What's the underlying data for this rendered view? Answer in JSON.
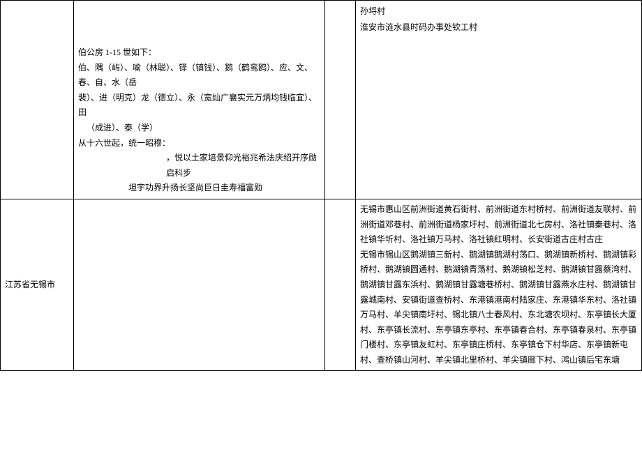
{
  "rows": [
    {
      "region": "",
      "lineage": {
        "title": "伯公房 1-15 世如下：",
        "line1": "伯、隅（屿）、喻（林聪）、铎（镇钱）、鹅（鹤鸾鸥）、应、文、春、自、水（岳",
        "line2": "裴）、进（明克）龙（德立）、永（宽灿广襄实元万炳均钱临宜）、田",
        "line3": "（成进）、泰（学）",
        "line4": "从十六世起，统一昭穆：",
        "line5": "，悦以土家培景仰光裕兆希法庆绍开序勋启科步",
        "line6": "坦宇功界升扬长坚尚巨日圭寿福富勋"
      },
      "locations": {
        "line1": "孙埒村",
        "line2": "淮安市涟水县时码办事处钦工村"
      }
    },
    {
      "region": "江苏省无锡市",
      "lineage": {},
      "locations": {
        "para1": "无锡市惠山区前洲街道黄石街村、前洲街道东村桥村、前洲街道友联村、前洲街道邓巷村、前洲街道杨家圩村、前洲街道北七房村、洛社镇秦巷村、洛社镇华圻村、洛社镇万马村、洛社镇红明村、长安街道古庄村古庄",
        "para2": "无锡市锡山区鹅湖镇三新村、鹅湖镇鹅湖村荡口、鹅湖镇新桥村、鹅湖镇彩桥村、鹅湖镇圆通村、鹅湖镇青荡村、鹅湖镇松芝村、鹅湖镇甘露蔡湾村、鹅湖镇甘露东浜村、鹅湖镇甘露塘巷桥村、鹅湖镇甘露燕水庄村、鹅湖镇甘露城南村、安镇街道查桥村、东港镇港南村陆家庄、东港镇华东村、洛社镇万马村、羊尖镇南圩村、锡北镇八士春风村、东北塘农坝村、东亭镇长大厦村、东亭镇长流村、东亭镇东亭村、东亭镇春合村、东亭镇春泉村、东亭镇门楼村、东亭镇友虹村、东亭镇庄桥村、东亭镇仓下村华店、东亭镇新屯村、查桥镇山河村、羊尖镇北里桥村、羊尖镇廊下村、鸿山镇后宅东塘"
      }
    }
  ]
}
